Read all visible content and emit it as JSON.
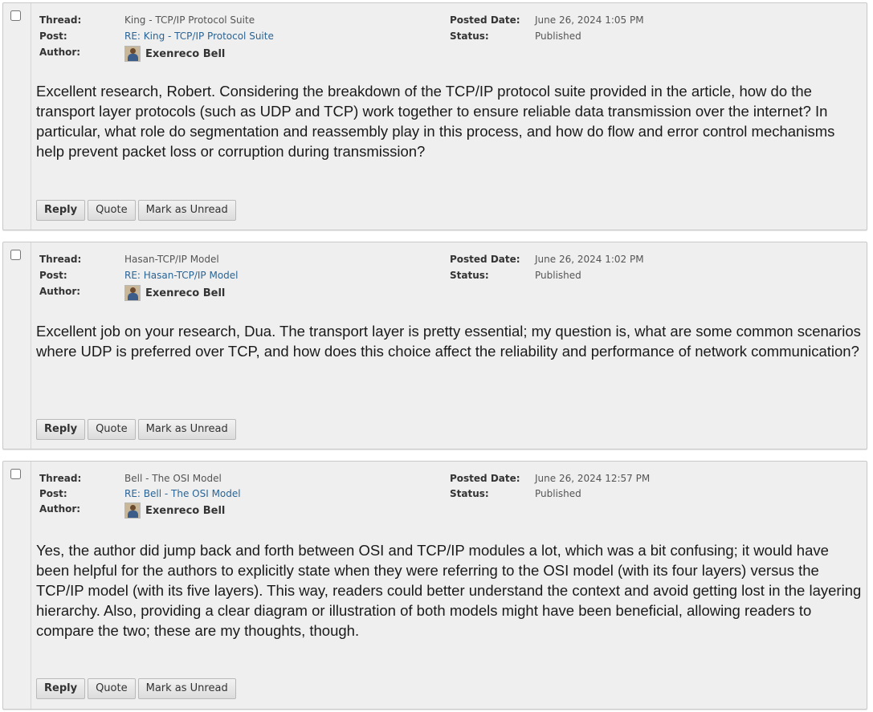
{
  "labels": {
    "thread": "Thread:",
    "post": "Post:",
    "author": "Author:",
    "posted_date": "Posted Date:",
    "status": "Status:"
  },
  "buttons": {
    "reply": "Reply",
    "quote": "Quote",
    "mark_unread": "Mark as Unread"
  },
  "posts": [
    {
      "thread": "King - TCP/IP Protocol Suite",
      "post": "RE: King - TCP/IP Protocol Suite",
      "author": "Exenreco Bell",
      "posted_date": "June 26, 2024 1:05 PM",
      "status": "Published",
      "body": "Excellent research, Robert. Considering the breakdown of the TCP/IP protocol suite provided in the article, how do the transport layer protocols (such as UDP and TCP) work together to ensure reliable data transmission over the internet? In particular, what role do segmentation and reassembly play in this process, and how do flow and error control mechanisms help prevent packet loss or corruption during transmission?"
    },
    {
      "thread": "Hasan-TCP/IP Model",
      "post": "RE: Hasan-TCP/IP Model",
      "author": "Exenreco Bell",
      "posted_date": "June 26, 2024 1:02 PM",
      "status": "Published",
      "body": "Excellent job on your research, Dua. The transport layer is pretty essential; my question is, what are some common scenarios where UDP is preferred over TCP, and how does this choice affect the reliability and performance of network communication?"
    },
    {
      "thread": "Bell - The OSI Model",
      "post": "RE: Bell - The OSI Model",
      "author": "Exenreco Bell",
      "posted_date": "June 26, 2024 12:57 PM",
      "status": "Published",
      "body": "Yes, the author did jump back and forth between OSI and TCP/IP modules a lot, which was a bit confusing; it would have been helpful for the authors to explicitly state when they were referring to the OSI model (with its four layers) versus the TCP/IP model (with its five layers). This way, readers could better understand the context and avoid getting lost in the layering hierarchy. Also, providing a clear diagram or illustration of both models might have been beneficial, allowing readers to compare the two; these are my thoughts, though."
    }
  ]
}
